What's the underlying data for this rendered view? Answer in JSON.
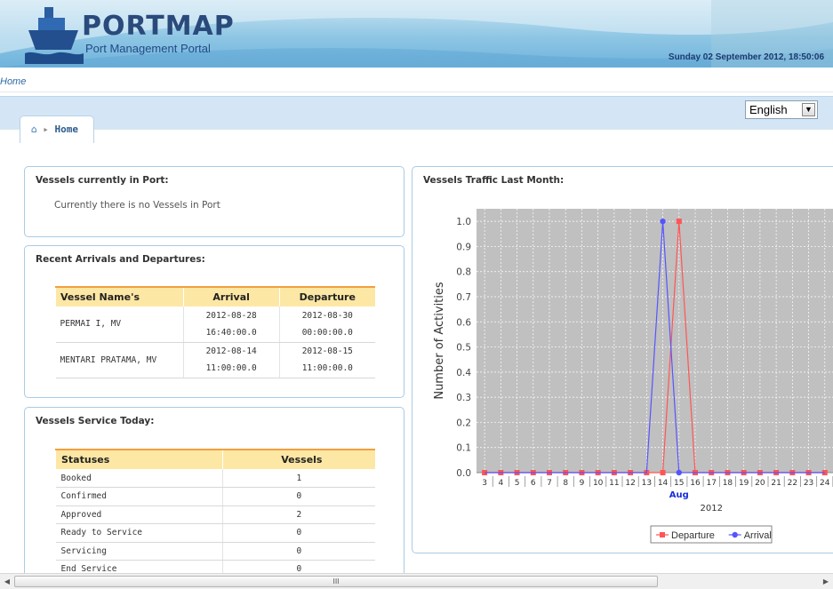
{
  "header": {
    "title": "PORTMAP",
    "subtitle": "Port Management Portal",
    "datetime": "Sunday 02 September 2012, 18:50:06"
  },
  "breadcrumb_top": "Home",
  "language": {
    "selected": "English"
  },
  "home_tab": {
    "label": "Home"
  },
  "in_port": {
    "title": "Vessels currently in Port:",
    "message": "Currently there is no Vessels in Port"
  },
  "recent": {
    "title": "Recent Arrivals and Departures:",
    "headers": [
      "Vessel Name's",
      "Arrival",
      "Departure"
    ],
    "rows": [
      {
        "name": "PERMAI I, MV",
        "arrival_date": "2012-08-28",
        "arrival_time": "16:40:00.0",
        "departure_date": "2012-08-30",
        "departure_time": "00:00:00.0"
      },
      {
        "name": "MENTARI PRATAMA, MV",
        "arrival_date": "2012-08-14",
        "arrival_time": "11:00:00.0",
        "departure_date": "2012-08-15",
        "departure_time": "11:00:00.0"
      }
    ]
  },
  "service": {
    "title": "Vessels Service Today:",
    "headers": [
      "Statuses",
      "Vessels"
    ],
    "rows": [
      {
        "status": "Booked",
        "vessels": "1"
      },
      {
        "status": "Confirmed",
        "vessels": "0"
      },
      {
        "status": "Approved",
        "vessels": "2"
      },
      {
        "status": "Ready to Service",
        "vessels": "0"
      },
      {
        "status": "Servicing",
        "vessels": "0"
      },
      {
        "status": "End Service",
        "vessels": "0"
      }
    ]
  },
  "traffic": {
    "title": "Vessels Traffic Last Month:"
  },
  "chart_data": {
    "type": "line",
    "ylabel": "Number of Activities",
    "x_month_label": "Aug",
    "x_year_label": "2012",
    "x": [
      "3",
      "4",
      "5",
      "6",
      "7",
      "8",
      "9",
      "10",
      "11",
      "12",
      "13",
      "14",
      "15",
      "16",
      "17",
      "18",
      "19",
      "20",
      "21",
      "22",
      "23",
      "24"
    ],
    "ylim": [
      0.0,
      1.05
    ],
    "yticks": [
      "0.0",
      "0.1",
      "0.2",
      "0.3",
      "0.4",
      "0.5",
      "0.6",
      "0.7",
      "0.8",
      "0.9",
      "1.0"
    ],
    "grid": true,
    "legend_position": "bottom",
    "series": [
      {
        "name": "Departure",
        "color": "#ff5555",
        "marker": "square",
        "values": [
          0,
          0,
          0,
          0,
          0,
          0,
          0,
          0,
          0,
          0,
          0,
          0,
          1,
          0,
          0,
          0,
          0,
          0,
          0,
          0,
          0,
          0
        ]
      },
      {
        "name": "Arrival",
        "color": "#5555ff",
        "marker": "circle",
        "values": [
          0,
          0,
          0,
          0,
          0,
          0,
          0,
          0,
          0,
          0,
          0,
          1,
          0,
          0,
          0,
          0,
          0,
          0,
          0,
          0,
          0,
          0
        ]
      }
    ]
  },
  "scrollbar": {
    "grip": "III"
  }
}
